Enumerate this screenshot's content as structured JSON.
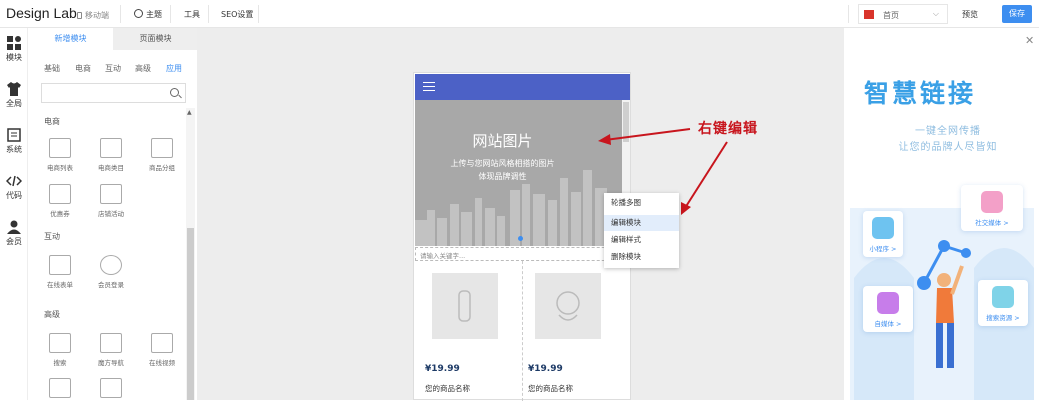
{
  "topbar": {
    "logo": "Design Lab",
    "mobile_tag": "移动端",
    "nav": [
      "主题",
      "工具",
      "SEO设置"
    ],
    "page_select": "首页",
    "preview": "预览",
    "save": "保存"
  },
  "iconbar": [
    "模块",
    "全局",
    "系统",
    "代码",
    "会员"
  ],
  "panel": {
    "tabs": [
      "新增模块",
      "页面模块"
    ],
    "subtabs": [
      "基础",
      "电商",
      "互动",
      "高级",
      "应用"
    ],
    "sections": [
      {
        "title": "电商",
        "items": [
          "电商列表",
          "电商类目",
          "商品分组",
          "优惠券",
          "店铺活动"
        ]
      },
      {
        "title": "互动",
        "items": [
          "在线表单",
          "会员登录"
        ]
      },
      {
        "title": "高级",
        "items": [
          "搜索",
          "魔方导航",
          "在线视频"
        ]
      }
    ]
  },
  "phone": {
    "banner_title": "网站图片",
    "banner_sub": [
      "上传与您网站风格相搭的图片",
      "体现品牌调性"
    ],
    "keyword_placeholder": "请输入关键字...",
    "products": [
      {
        "price": "¥19.99",
        "name": "您的商品名称"
      },
      {
        "price": "¥19.99",
        "name": "您的商品名称"
      }
    ]
  },
  "context_menu": [
    "轮播多图",
    "编辑模块",
    "编辑样式",
    "删除模块"
  ],
  "annotation": "右键编辑",
  "promo": {
    "title": "智慧链接",
    "subtitle": [
      "一键全网传播",
      "让您的品牌人尽皆知"
    ],
    "cards": [
      "小程序 >",
      "社交媒体 >",
      "自媒体 >",
      "搜索资源 >"
    ]
  },
  "colors": {
    "accent": "#3d8ef0",
    "phone_header": "#4c61c6",
    "annotation": "#c8151d"
  }
}
